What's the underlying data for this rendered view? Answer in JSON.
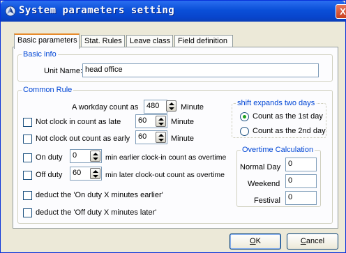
{
  "window": {
    "title": "System parameters setting",
    "close_label": "X"
  },
  "tabs": [
    {
      "label": "Basic parameters",
      "active": true
    },
    {
      "label": "Stat. Rules",
      "active": false
    },
    {
      "label": "Leave class",
      "active": false
    },
    {
      "label": "Field definition",
      "active": false
    }
  ],
  "basic_info": {
    "legend": "Basic info",
    "unit_name_label": "Unit Name:",
    "unit_name_value": "head office"
  },
  "common_rule": {
    "legend": "Common Rule",
    "workday_label": "A workday count as",
    "workday_value": "480",
    "workday_unit": "Minute",
    "late_label": "Not clock in count as late",
    "late_value": "60",
    "late_unit": "Minute",
    "early_label": "Not clock out count as early",
    "early_value": "60",
    "early_unit": "Minute",
    "on_duty_label": "On duty",
    "on_duty_value": "0",
    "on_duty_suffix": "min earlier clock-in count as overtime",
    "off_duty_label": "Off duty",
    "off_duty_value": "60",
    "off_duty_suffix": "min later clock-out count as overtime",
    "deduct_on_label": "deduct the 'On duty X minutes earlier'",
    "deduct_off_label": "deduct the 'Off duty X minutes later'"
  },
  "shift": {
    "legend": "shift expands two days",
    "option1": "Count as the 1st day",
    "option2": "Count as the 2nd day"
  },
  "overtime": {
    "legend": "Overtime Calculation",
    "normal_label": "Normal Day",
    "normal_value": "0",
    "weekend_label": "Weekend",
    "weekend_value": "0",
    "festival_label": "Festival",
    "festival_value": "0"
  },
  "buttons": {
    "ok_mnemonic": "O",
    "ok_rest": "K",
    "cancel_mnemonic": "C",
    "cancel_rest": "ancel"
  }
}
